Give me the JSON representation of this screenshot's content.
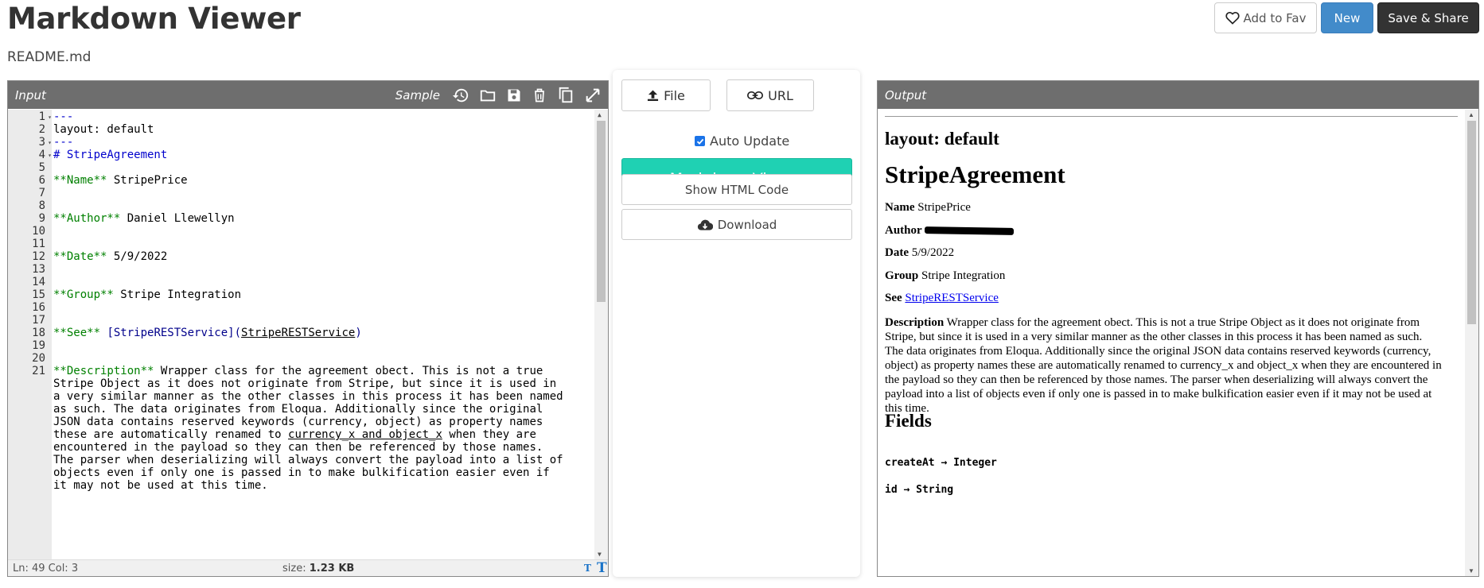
{
  "header": {
    "title": "Markdown Viewer",
    "file_name": "README.md",
    "fav_label": "Add to Fav",
    "new_label": "New",
    "save_label": "Save & Share"
  },
  "input_panel": {
    "title": "Input",
    "sample_label": "Sample",
    "tools": [
      "history-icon",
      "folder-icon",
      "save-icon",
      "trash-icon",
      "copy-icon",
      "expand-icon"
    ],
    "lines": [
      {
        "n": "1",
        "text": "---"
      },
      {
        "n": "2",
        "text": "layout: default"
      },
      {
        "n": "3",
        "text": "---"
      },
      {
        "n": "4",
        "text": "# StripeAgreement"
      },
      {
        "n": "5",
        "text": ""
      },
      {
        "n": "6",
        "bold": "**Name**",
        "rest": " StripePrice"
      },
      {
        "n": "7",
        "text": ""
      },
      {
        "n": "8",
        "text": ""
      },
      {
        "n": "9",
        "bold": "**Author**",
        "rest": " Daniel Llewellyn"
      },
      {
        "n": "10",
        "text": ""
      },
      {
        "n": "11",
        "text": ""
      },
      {
        "n": "12",
        "bold": "**Date**",
        "rest": " 5/9/2022"
      },
      {
        "n": "13",
        "text": ""
      },
      {
        "n": "14",
        "text": ""
      },
      {
        "n": "15",
        "bold": "**Group**",
        "rest": " Stripe Integration"
      },
      {
        "n": "16",
        "text": ""
      },
      {
        "n": "17",
        "text": ""
      },
      {
        "n": "18",
        "bold": "**See**",
        "link_text": " [StripeRESTService](",
        "link_url": "StripeRESTService",
        "link_end": ")"
      },
      {
        "n": "19",
        "text": ""
      },
      {
        "n": "20",
        "text": ""
      },
      {
        "n": "21",
        "bold": "**Description**",
        "rest": " Wrapper class for the agreement obect. This is not a true"
      }
    ],
    "wrapped": [
      "Stripe Object as it does not originate from Stripe, but since it is used in",
      "a very similar manner as the other classes in this process it has been named",
      "as such. The data originates from Eloqua. Additionally since the original",
      "JSON data contains reserved keywords (currency, object) as property names",
      "these are automatically renamed to currency_x and object_x when they are",
      "encountered in the payload so they can then be referenced by those names.",
      "The parser when deserializing will always convert the payload into a list of",
      "objects even if only one is passed in to make bulkification easier even if",
      "it may not be used at this time."
    ],
    "status_position": "Ln: 49 Col: 3",
    "status_size_label": "size:",
    "status_size_value": "1.23 KB"
  },
  "middle": {
    "file_label": "File",
    "url_label": "URL",
    "auto_update_label": "Auto Update",
    "auto_update_checked": true,
    "markdown_viewer_label": "Markdown Viewer",
    "show_html_label": "Show HTML Code",
    "download_label": "Download"
  },
  "output_panel": {
    "title": "Output",
    "layout_heading": "layout: default",
    "main_heading": "StripeAgreement",
    "name_label": "Name",
    "name_value": "StripePrice",
    "author_label": "Author",
    "date_label": "Date",
    "date_value": "5/9/2022",
    "group_label": "Group",
    "group_value": "Stripe Integration",
    "see_label": "See",
    "see_link": "StripeRESTService",
    "description_label": "Description",
    "description_text": "Wrapper class for the agreement obect. This is not a true Stripe Object as it does not originate from Stripe, but since it is used in a very similar manner as the other classes in this process it has been named as such. The data originates from Eloqua. Additionally since the original JSON data contains reserved keywords (currency, object) as property names these are automatically renamed to currency_x and object_x when they are encountered in the payload so they can then be referenced by those names. The parser when deserializing will always convert the payload into a list of objects even if only one is passed in to make bulkification easier even if it may not be used at this time.",
    "fields_heading": "Fields",
    "field_1": "createAt → Integer",
    "field_2": "id → String"
  },
  "colors": {
    "new_button": "#428bca",
    "save_button": "#333333",
    "markdown_button": "#1fd1b3",
    "panel_header": "#6e6e6e"
  }
}
